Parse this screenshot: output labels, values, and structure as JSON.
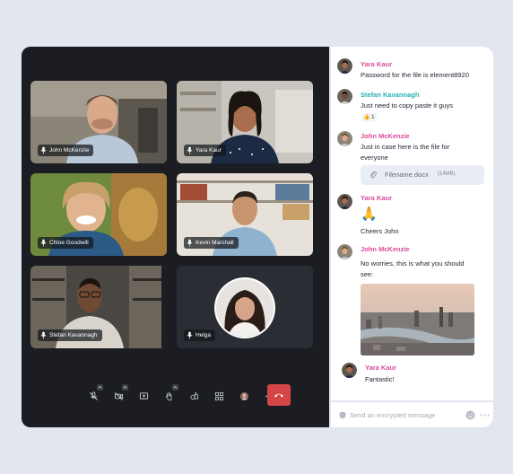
{
  "participants": [
    {
      "name": "John McKenzie"
    },
    {
      "name": "Yara Kaur"
    },
    {
      "name": "Chloe Goodwill"
    },
    {
      "name": "Kevin Marshall"
    },
    {
      "name": "Stefan Kavannagh"
    },
    {
      "name": "Helga"
    }
  ],
  "controls": [
    "mute-mic-icon",
    "camera-off-icon",
    "share-screen-icon",
    "raise-hand-icon",
    "reactions-icon",
    "grid-view-icon",
    "avatar-icon",
    "more-icon",
    "end-call-icon"
  ],
  "colors": {
    "author_pink": "#d94a9a",
    "author_teal": "#26b3b0",
    "end_call": "#d64545",
    "panel_dark": "#1b1d22"
  },
  "chat": {
    "messages": [
      {
        "author": "Yara Kaur",
        "text": "Password for the file is element8920"
      },
      {
        "author": "Stefan Kavannagh",
        "text": "Just need to copy paste it guys",
        "reaction_count": "1"
      },
      {
        "author": "John McKenzie",
        "text_line1": "Just in case here is the file for",
        "text_line2": "everyone",
        "file_name": "Filename.docx",
        "file_size": "(14MB)"
      },
      {
        "author": "Yara Kaur",
        "emoji": "🙏",
        "text": "Cheers John"
      },
      {
        "author": "John McKenzie",
        "text_line1": "No worries, this is what you should",
        "text_line2": "see:"
      },
      {
        "author": "Yara Kaur",
        "text": "Fantastic!"
      }
    ],
    "reaction_emoji": "👍",
    "composer_placeholder": "Send an encrypted message"
  }
}
